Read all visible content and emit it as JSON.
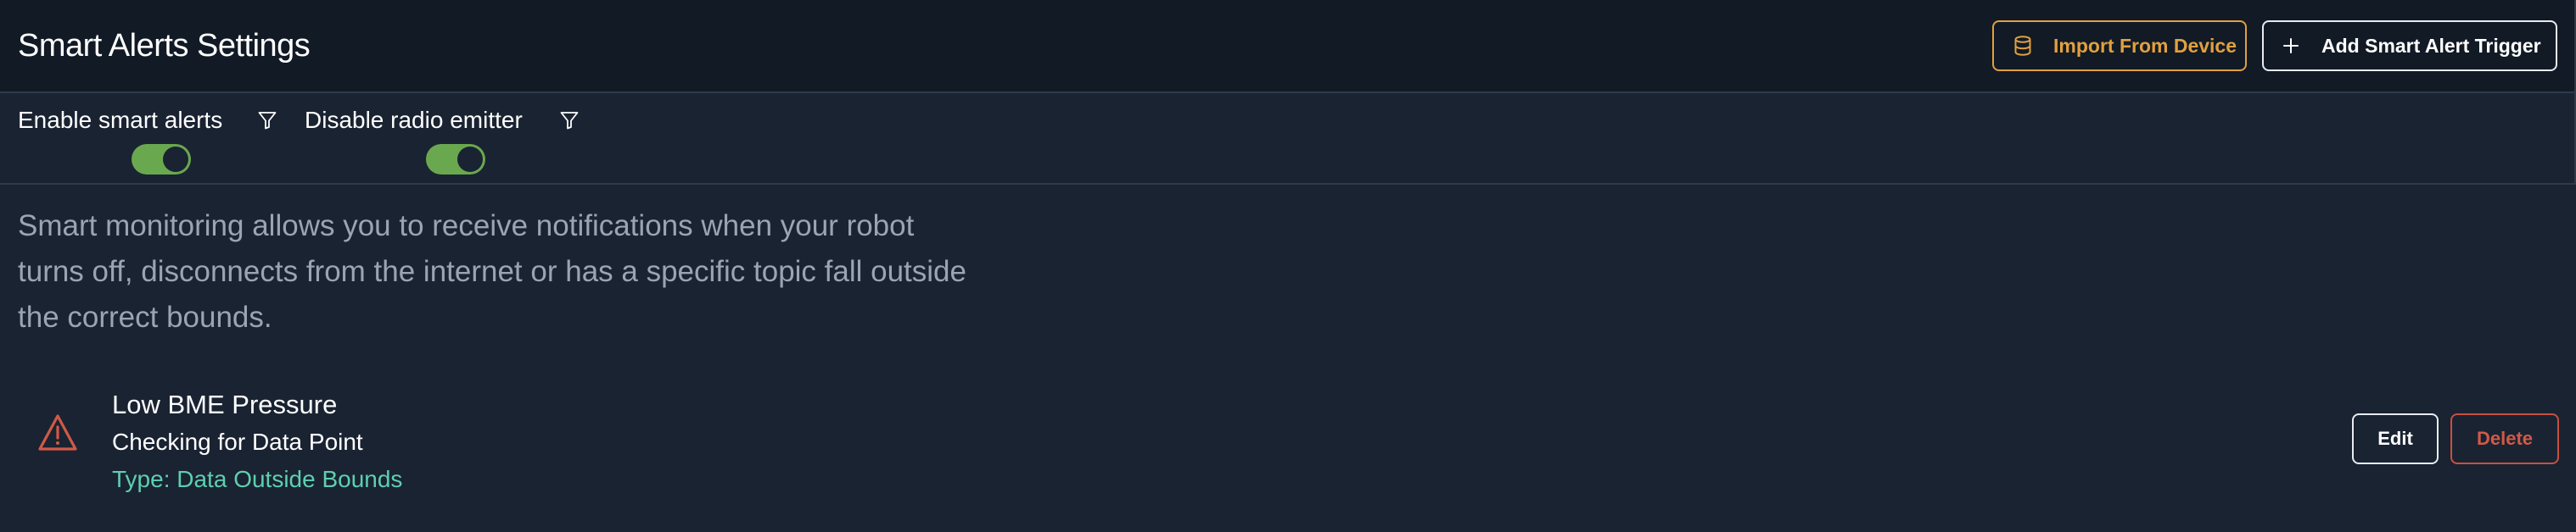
{
  "header": {
    "title": "Smart Alerts Settings",
    "import_label": "Import From Device",
    "add_label": "Add Smart Alert Trigger"
  },
  "filters": [
    {
      "label": "Enable smart alerts",
      "enabled": true,
      "icon": "filter-icon"
    },
    {
      "label": "Disable radio emitter",
      "enabled": true,
      "icon": "filter-icon"
    }
  ],
  "description": "Smart monitoring allows you to receive notifications when your robot turns off, disconnects from the internet or has a specific topic fall outside the correct bounds.",
  "alerts": [
    {
      "title": "Low BME Pressure",
      "subtitle": "Checking for Data Point",
      "type_prefix": "Type:",
      "type_value": "Data Outside Bounds",
      "icon": "warning-triangle-icon",
      "edit_label": "Edit",
      "delete_label": "Delete"
    }
  ],
  "colors": {
    "background": "#1a2332",
    "header_background": "#111a25",
    "import_accent": "#e2a03f",
    "toggle_on": "#6aa84f",
    "type_text": "#5ecfb0",
    "danger": "#d05a47",
    "muted_text": "#9aa4b2"
  }
}
